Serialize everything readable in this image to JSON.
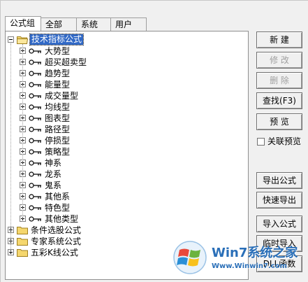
{
  "tabs": [
    {
      "label": "公式组",
      "active": true
    },
    {
      "label": "全部",
      "active": false
    },
    {
      "label": "系统",
      "active": false
    },
    {
      "label": "用户",
      "active": false
    }
  ],
  "tree": {
    "root": {
      "label": "技术指标公式",
      "expanded": true,
      "selected": true
    },
    "children": [
      "大势型",
      "超买超卖型",
      "趋势型",
      "能量型",
      "成交量型",
      "均线型",
      "图表型",
      "路径型",
      "停损型",
      "策略型",
      "神系",
      "龙系",
      "鬼系",
      "其他系",
      "特色型",
      "其他类型"
    ],
    "other_groups": [
      {
        "label": "条件选股公式",
        "expanded": false
      },
      {
        "label": "专家系统公式",
        "expanded": false
      },
      {
        "label": "五彩K线公式",
        "expanded": false
      }
    ]
  },
  "buttons": {
    "new": "新  建",
    "edit": "修  改",
    "delete": "删  除",
    "find": "查找(F3)",
    "preview": "预  览",
    "export": "导出公式",
    "quick_export": "快速导出",
    "import": "导入公式",
    "temp_import": "临时导入",
    "dll": "DLL函数"
  },
  "checkbox": {
    "label": "关联预览",
    "checked": false
  },
  "watermark": {
    "brand": "Win7系统之家",
    "url": "Www.Winwin7.com"
  },
  "colors": {
    "selection": "#3169c6",
    "folder": "#f5d76e",
    "watermark": "#2a6fb8"
  }
}
